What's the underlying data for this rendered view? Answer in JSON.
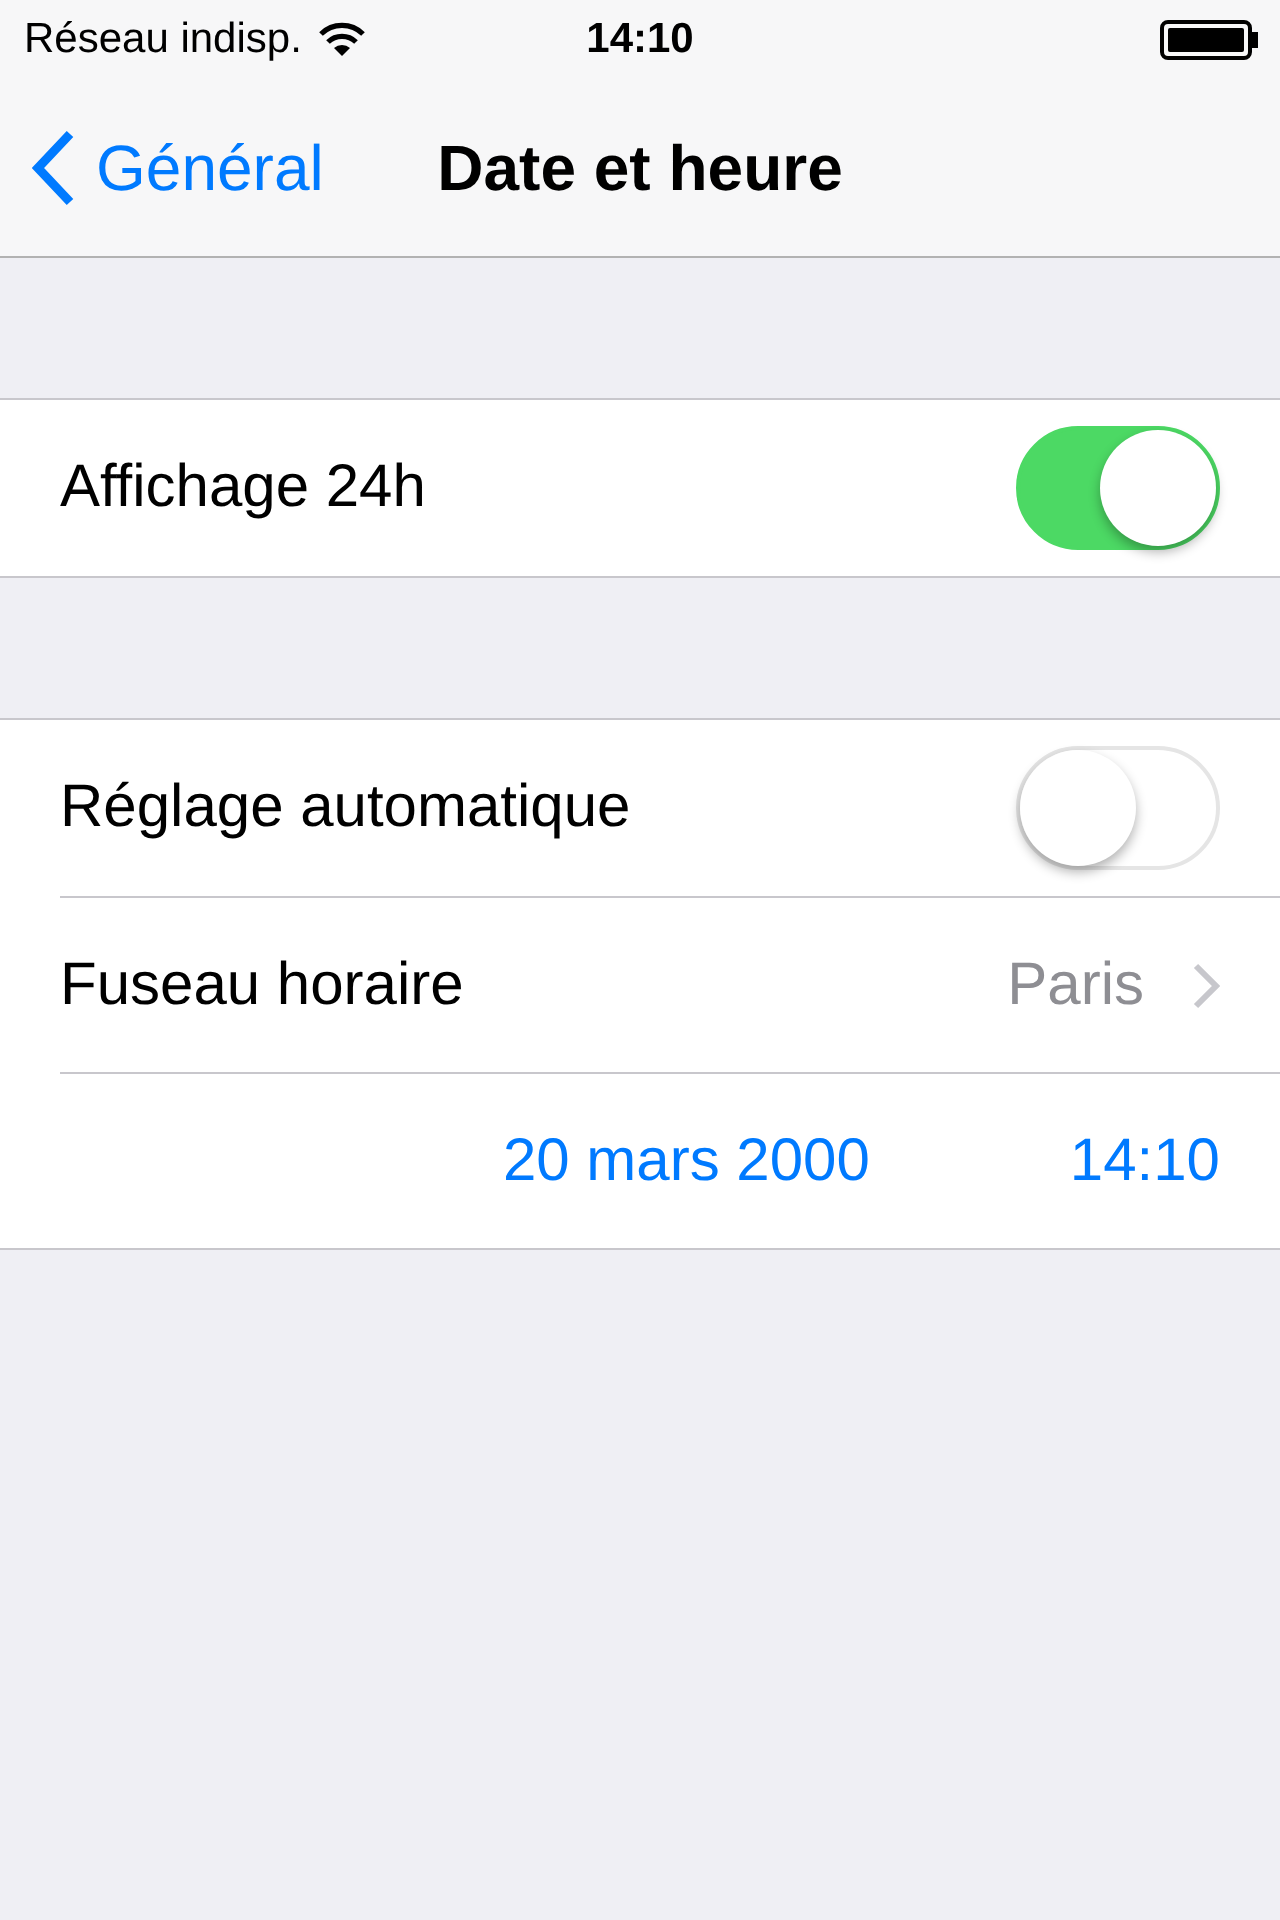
{
  "status_bar": {
    "carrier": "Réseau indisp.",
    "time": "14:10"
  },
  "nav_bar": {
    "back_label": "Général",
    "title": "Date et heure"
  },
  "groups": [
    {
      "rows": [
        {
          "kind": "toggle",
          "label": "Affichage 24h",
          "on": true
        }
      ]
    },
    {
      "rows": [
        {
          "kind": "toggle",
          "label": "Réglage automatique",
          "on": false
        },
        {
          "kind": "disclosure",
          "label": "Fuseau horaire",
          "value": "Paris"
        },
        {
          "kind": "datetime",
          "date": "20 mars 2000",
          "time": "14:10"
        }
      ]
    }
  ]
}
